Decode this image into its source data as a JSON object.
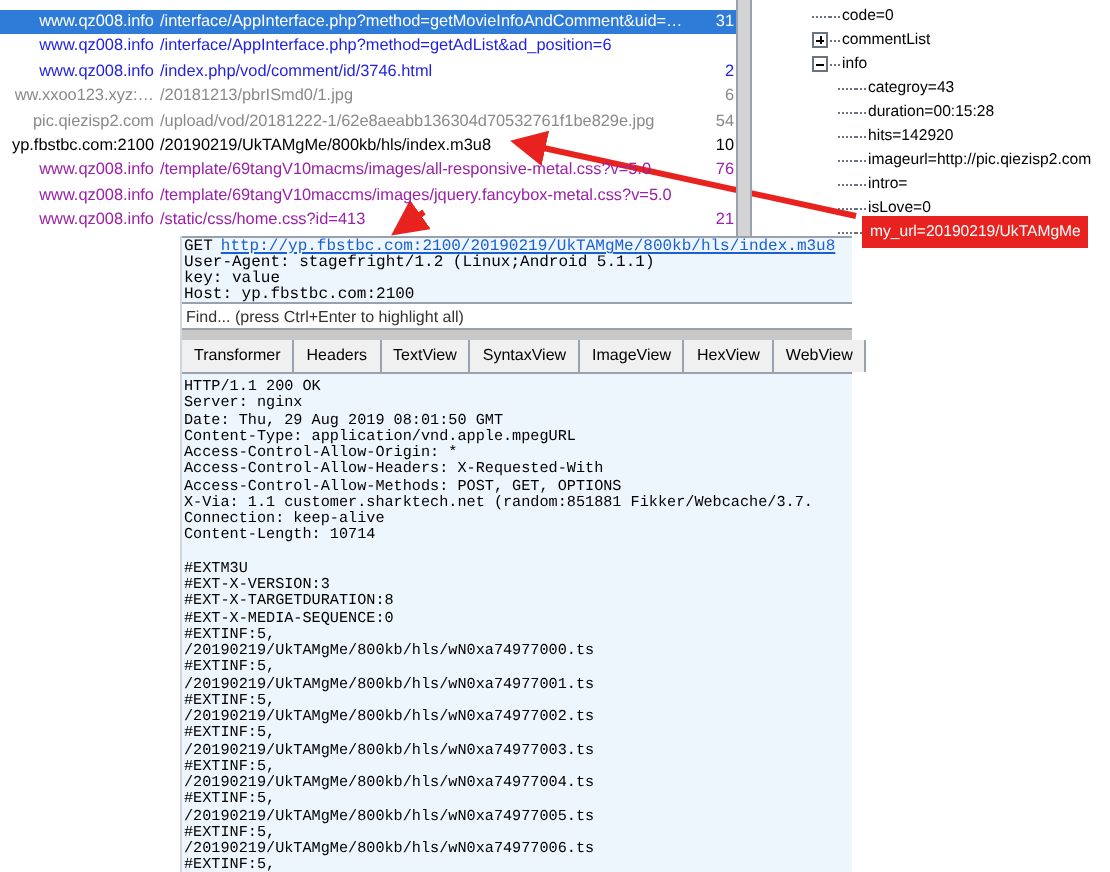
{
  "sessions": [
    {
      "host": "www.qz008.info",
      "url": "/interface/AppInterface.php?method=getMovieInfoAndComment&uid=…",
      "column_3": "31",
      "selected": true
    },
    {
      "host": "www.qz008.info",
      "url": "/interface/AppInterface.php?method=getAdList&ad_position=6",
      "color": "#1f1fe0",
      "selected": false
    },
    {
      "host": "www.qz008.info",
      "url": "/index.php/vod/comment/id/3746.html",
      "column_3": "2",
      "color": "#1f1fe0",
      "selected": false
    },
    {
      "host": "ww.xxoo123.xyz:…",
      "url": "/20181213/pbrISmd0/1.jpg",
      "column_3": "6",
      "color": "#8a8a8a",
      "selected": false
    },
    {
      "host": "pic.qiezisp2.com",
      "url": "/upload/vod/20181222-1/62e8aeabb136304d70532761f1be829e.jpg",
      "column_3": "54",
      "color": "#8a8a8a",
      "selected": false
    },
    {
      "host": "yp.fbstbc.com:2100",
      "url": "/20190219/UkTAMgMe/800kb/hls/index.m3u8",
      "column_3": "10",
      "color": "#000000",
      "selected": false
    },
    {
      "host": "www.qz008.info",
      "url": "/template/69tangV10macms/images/all-responsive-metal.css?v=5.0",
      "column_3": "76",
      "color": "#9b1fa8",
      "selected": false
    },
    {
      "host": "www.qz008.info",
      "url": "/template/69tangV10maccms/images/jquery.fancybox-metal.css?v=5.0",
      "color": "#9b1fa8",
      "selected": false
    },
    {
      "host": "www.qz008.info",
      "url": "/static/css/home.css?id=413",
      "column_3": "21",
      "color": "#9b1fa8",
      "selected": false
    }
  ],
  "tree": [
    {
      "label": "code=0"
    },
    {
      "label": "commentList",
      "expanded": false
    },
    {
      "label": "info",
      "expanded": true,
      "children": [
        {
          "label": "categroy=43"
        },
        {
          "label": "duration=00:15:28"
        },
        {
          "label": "hits=142920"
        },
        {
          "label": "imageurl=http://pic.qiezisp2.com"
        },
        {
          "label": "intro="
        },
        {
          "label": "isLove=0"
        },
        {
          "label": "my_url=20190219/UkTAMgMe",
          "selected": true
        }
      ]
    }
  ],
  "request": {
    "method": "GET",
    "url": "http://yp.fbstbc.com:2100/20190219/UkTAMgMe/800kb/hls/index.m3u8",
    "headers": [
      "User-Agent: stagefright/1.2 (Linux;Android 5.1.1)",
      "key: value",
      "Host: yp.fbstbc.com:2100"
    ]
  },
  "find": {
    "placeholder": "Find... (press Ctrl+Enter to highlight all)"
  },
  "tabs": [
    {
      "label": "Transformer",
      "selected": false
    },
    {
      "label": "Headers",
      "selected": false
    },
    {
      "label": "TextView",
      "selected": false
    },
    {
      "label": "SyntaxView",
      "selected": false
    },
    {
      "label": "ImageView",
      "selected": false
    },
    {
      "label": "HexView",
      "selected": false
    },
    {
      "label": "WebView",
      "selected": false
    }
  ],
  "response": [
    "HTTP/1.1 200 OK",
    "Server: nginx",
    "Date: Thu, 29 Aug 2019 08:01:50 GMT",
    "Content-Type: application/vnd.apple.mpegURL",
    "Access-Control-Allow-Origin: *",
    "Access-Control-Allow-Headers: X-Requested-With",
    "Access-Control-Allow-Methods: POST, GET, OPTIONS",
    "X-Via: 1.1 customer.sharktech.net (random:851881 Fikker/Webcache/3.7.",
    "Connection: keep-alive",
    "Content-Length: 10714"
  ],
  "response_body": [
    "#EXTM3U",
    "#EXT-X-VERSION:3",
    "#EXT-X-TARGETDURATION:8",
    "#EXT-X-MEDIA-SEQUENCE:0",
    "#EXTINF:5,",
    "/20190219/UkTAMgMe/800kb/hls/wN0xa74977000.ts",
    "#EXTINF:5,",
    "/20190219/UkTAMgMe/800kb/hls/wN0xa74977001.ts",
    "#EXTINF:5,",
    "/20190219/UkTAMgMe/800kb/hls/wN0xa74977002.ts",
    "#EXTINF:5,",
    "/20190219/UkTAMgMe/800kb/hls/wN0xa74977003.ts",
    "#EXTINF:5,",
    "/20190219/UkTAMgMe/800kb/hls/wN0xa74977004.ts",
    "#EXTINF:5,",
    "/20190219/UkTAMgMe/800kb/hls/wN0xa74977005.ts",
    "#EXTINF:5,",
    "/20190219/UkTAMgMe/800kb/hls/wN0xa74977006.ts",
    "#EXTINF:5,"
  ]
}
